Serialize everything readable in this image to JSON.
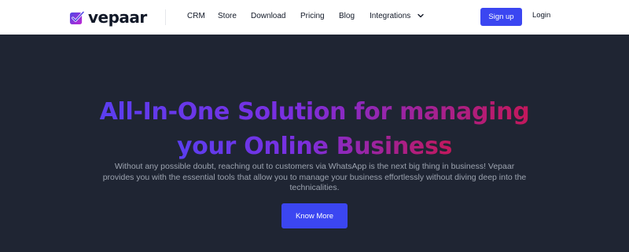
{
  "brand": {
    "name": "vepaar",
    "accent": "#3b46f1",
    "logo_colors": [
      "#4f46e5",
      "#c026d3"
    ]
  },
  "nav": {
    "links": [
      "CRM",
      "Store",
      "Download",
      "Pricing",
      "Blog",
      "Integrations"
    ],
    "integrations_icon": "chevron-down-icon",
    "signup_label": "Sign up",
    "login_label": "Login"
  },
  "hero": {
    "title_line1": "All-In-One Solution for managing",
    "title_line2": "your Online Business",
    "subtitle": "Without any possible doubt, reaching out to customers via WhatsApp is the next big thing in business! Vepaar provides you with the essential tools that allow you to manage your business effortlessly without diving deep into the technicalities.",
    "cta_label": "Know More",
    "background": "#1f2533"
  }
}
